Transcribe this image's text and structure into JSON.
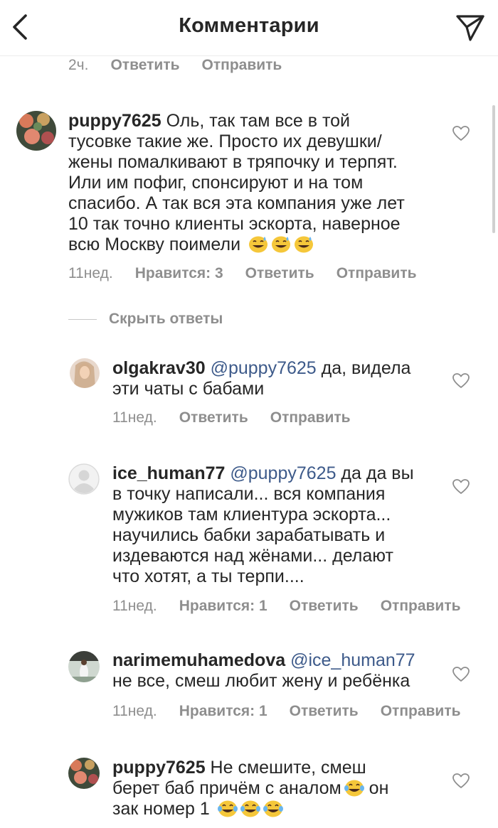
{
  "header": {
    "title": "Комментарии",
    "back_icon": "chevron-left-icon",
    "share_icon": "paper-plane-icon"
  },
  "top_meta": {
    "time": "2ч.",
    "reply": "Ответить",
    "send": "Отправить"
  },
  "comments": [
    {
      "username": "puppy7625",
      "text_lines": [
        "Оль, так там все в той",
        "тусовке такие же. Просто их девушки/",
        "жены помалкивают в тряпочку и терпят.",
        "Или им пофиг, спонсируют и на том",
        "спасибо. А так вся эта компания уже лет",
        "10 так точно клиенты эскорта, наверное",
        "всю Москву поимели"
      ],
      "time": "11нед.",
      "likes": "Нравится: 3",
      "reply": "Ответить",
      "send": "Отправить"
    }
  ],
  "hide_replies": "Скрыть ответы",
  "replies": [
    {
      "username": "olgakrav30",
      "mention": "@puppy7625",
      "line1": " да, видела",
      "line2": "эти чаты с бабами",
      "time": "11нед.",
      "reply": "Ответить",
      "send": "Отправить"
    },
    {
      "username": "ice_human77",
      "mention": "@puppy7625",
      "line1": " да да вы",
      "lines": [
        "в точку написали... вся компания",
        "мужиков там клиентура эскорта...",
        "научились бабки зарабатывать и",
        "издеваются над жёнами... делают",
        "что хотят, а ты терпи...."
      ],
      "time": "11нед.",
      "likes": "Нравится: 1",
      "reply": "Ответить",
      "send": "Отправить"
    },
    {
      "username": "narimemuhamedova",
      "mention": "@ice_human77",
      "line2": "не все, смеш любит жену и ребёнка",
      "time": "11нед.",
      "likes": "Нравится: 1",
      "reply": "Ответить",
      "send": "Отправить"
    },
    {
      "username": "puppy7625",
      "line1": " Не смешите, смеш",
      "line2a": "берет баб причём с аналом",
      "line2b": " он",
      "line3": "зак номер 1"
    }
  ],
  "colors": {
    "text": "#262626",
    "meta": "#8e8e8e",
    "mention": "#3d5a8a"
  }
}
